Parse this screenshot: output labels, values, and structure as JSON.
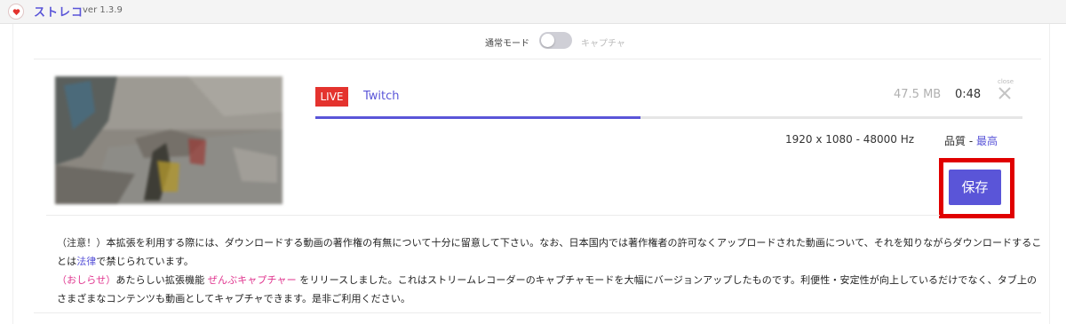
{
  "header": {
    "app_name": "ストレコ",
    "version": "ver 1.3.9"
  },
  "mode": {
    "left_label": "通常モード",
    "right_label": "キャプチャ",
    "capture_enabled": false
  },
  "recording": {
    "badge": "LIVE",
    "platform": "Twitch",
    "size": "47.5 MB",
    "duration": "0:48",
    "close_label": "close",
    "progress_percent": 46,
    "resolution": "1920 x 1080 - 48000 Hz",
    "quality_label": "品質 - ",
    "quality_value": "最高",
    "save_label": "保存"
  },
  "notice": {
    "warning_head": "（注意！）",
    "warning_text_1": "本拡張を利用する際には、ダウンロードする動画の著作権の有無について十分に留意して下さい。なお、日本国内では著作権者の許可なくアップロードされた動画について、それを知りながらダウンロードすることは",
    "warning_link": "法律",
    "warning_text_2": "で禁じられています。",
    "info_head": "（おしらせ）",
    "info_text_1": "あたらしい拡張機能 ",
    "info_product": "ぜんぶキャプチャー",
    "info_text_2": " をリリースしました。これはストリームレコーダーのキャプチャモードを大幅にバージョンアップしたものです。利便性・安定性が向上しているだけでなく、タブ上のさまざまなコンテンツも動画としてキャプチャできます。是非ご利用ください。"
  },
  "colors": {
    "accent": "#5a55d8",
    "live_red": "#e4332e",
    "highlight_red": "#e00000",
    "pink": "#e0338e"
  },
  "icons": [
    "heart-logo-icon",
    "close-icon"
  ]
}
